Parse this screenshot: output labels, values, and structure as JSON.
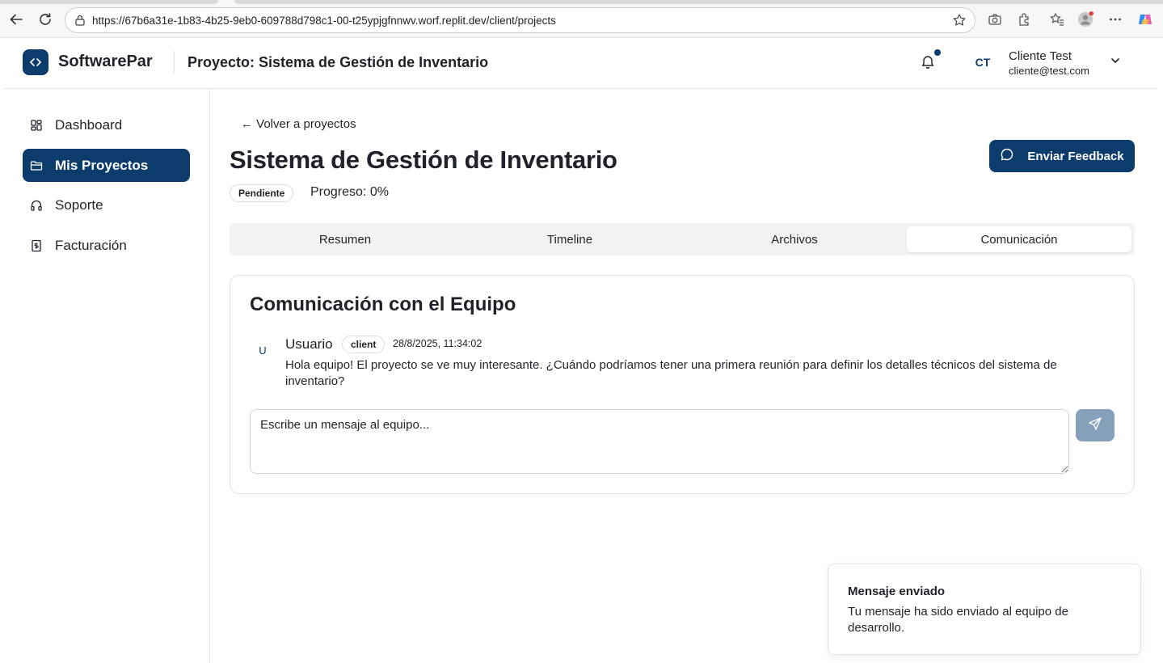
{
  "browser": {
    "url": "https://67b6a31e-1b83-4b25-9eb0-609788d798c1-00-t25ypjgfnnwv.worf.replit.dev/client/projects"
  },
  "header": {
    "brand": "SoftwarePar",
    "title": "Proyecto: Sistema de Gestión de Inventario",
    "user": {
      "initials": "CT",
      "name": "Cliente Test",
      "email": "cliente@test.com"
    }
  },
  "sidebar": {
    "items": [
      {
        "label": "Dashboard",
        "icon": "grid-icon"
      },
      {
        "label": "Mis Proyectos",
        "icon": "folder-icon"
      },
      {
        "label": "Soporte",
        "icon": "headphones-icon"
      },
      {
        "label": "Facturación",
        "icon": "receipt-icon"
      }
    ]
  },
  "main": {
    "back_label": "← Volver a proyectos",
    "project_title": "Sistema de Gestión de Inventario",
    "status": "Pendiente",
    "progress": "Progreso: 0%",
    "feedback_label": "Enviar Feedback",
    "tabs": [
      {
        "label": "Resumen"
      },
      {
        "label": "Timeline"
      },
      {
        "label": "Archivos"
      },
      {
        "label": "Comunicación"
      }
    ]
  },
  "communication": {
    "title": "Comunicación con el Equipo",
    "message": {
      "avatar": "U",
      "author": "Usuario",
      "role": "client",
      "time": "28/8/2025, 11:34:02",
      "text": "Hola equipo! El proyecto se ve muy interesante. ¿Cuándo podríamos tener una primera reunión para definir los detalles técnicos del sistema de inventario?"
    },
    "input_placeholder": "Escribe un mensaje al equipo..."
  },
  "toast": {
    "title": "Mensaje enviado",
    "text": "Tu mensaje ha sido enviado al equipo de desarrollo."
  },
  "colors": {
    "brand": "#0b3c6b",
    "send_disabled": "#87a0b9"
  }
}
